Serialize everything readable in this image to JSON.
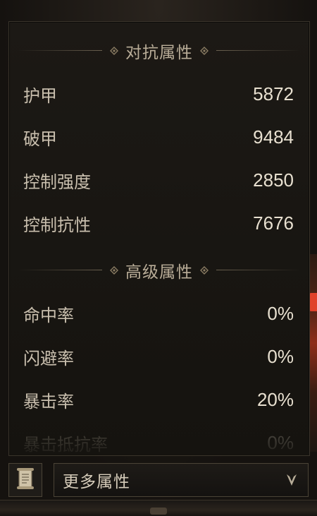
{
  "sections": [
    {
      "title": "对抗属性",
      "rows": [
        {
          "label": "护甲",
          "value": "5872"
        },
        {
          "label": "破甲",
          "value": "9484"
        },
        {
          "label": "控制强度",
          "value": "2850"
        },
        {
          "label": "控制抗性",
          "value": "7676"
        }
      ]
    },
    {
      "title": "高级属性",
      "rows": [
        {
          "label": "命中率",
          "value": "0%"
        },
        {
          "label": "闪避率",
          "value": "0%"
        },
        {
          "label": "暴击率",
          "value": "20%"
        },
        {
          "label": "暴击抵抗率",
          "value": "0%"
        }
      ]
    }
  ],
  "footer": {
    "more_label": "更多属性",
    "scroll_icon": "scroll-icon",
    "dropdown_icon": "chevron-down-icon"
  },
  "colors": {
    "label": "#c9bfae",
    "value": "#e8e0d0",
    "header": "#b9ad98",
    "accent_red": "#e0412a"
  }
}
